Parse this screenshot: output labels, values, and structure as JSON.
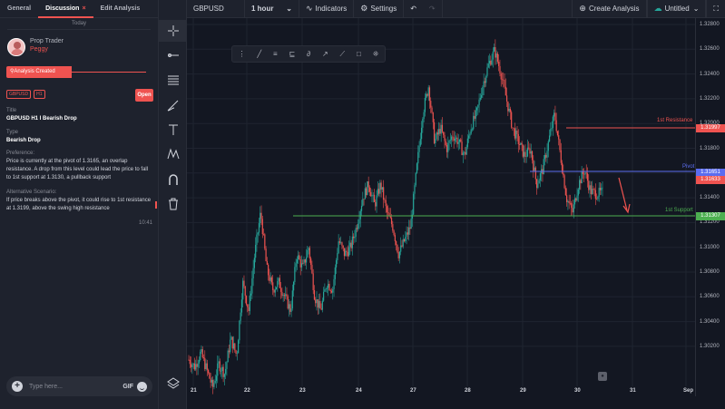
{
  "tabs": [
    {
      "label": "General"
    },
    {
      "label": "Discussion",
      "close": "×"
    },
    {
      "label": "Edit Analysis"
    }
  ],
  "today": "Today",
  "user": {
    "role": "Prop Trader",
    "name": "Peggy"
  },
  "created_label": "Analysis Created",
  "tags": [
    "GBPUSD",
    "H1"
  ],
  "open_label": "Open",
  "fields": {
    "title_label": "Title",
    "title_value": "GBPUSD H1 I Bearish Drop",
    "type_label": "Type",
    "type_value": "Bearish Drop",
    "preference_label": "Preference:",
    "preference_text": "Price is currently at the pivot of 1.3165, an overlap resistance. A drop from this level could lead the price to fall to 1st support at 1.3130, a pullback support",
    "alt_label": "Alternative Scenario:",
    "alt_text": "If price breaks above the pivot, it could rise to 1st resistance at 1.3199, above the swing high resistance"
  },
  "message_time": "10:41",
  "input": {
    "placeholder": "Type here...",
    "gif": "GIF"
  },
  "topbar": {
    "symbol": "GBPUSD",
    "timeframe": "1 hour",
    "indicators": "Indicators",
    "settings": "Settings",
    "create": "Create Analysis",
    "untitled": "Untitled"
  },
  "colors": {
    "accent": "#ef5350",
    "up": "#26a69a",
    "down": "#ef5350",
    "pivot": "#5b6cf0",
    "support": "#4caf50"
  },
  "price_labels": [
    "1.32800",
    "1.32600",
    "1.32400",
    "1.32200",
    "1.32000",
    "1.31800",
    "1.31600",
    "1.31400",
    "1.31200",
    "1.31000",
    "1.30800",
    "1.30600",
    "1.30400",
    "1.30200"
  ],
  "date_labels": [
    "21",
    "22",
    "23",
    "24",
    "27",
    "28",
    "29",
    "30",
    "31",
    "Sep"
  ],
  "levels": {
    "resistance": {
      "label": "1st Resistance",
      "price_tag": "1.31997"
    },
    "pivot": {
      "label": "Pivot",
      "price_tag": "1.31651"
    },
    "current": {
      "price_tag": "1.31633"
    },
    "support": {
      "label": "1st Support",
      "price_tag": "1.31307"
    }
  },
  "chart_data": {
    "type": "candlestick",
    "ylim": [
      1.3019,
      1.3288
    ],
    "x": [
      "21",
      "22",
      "23",
      "24",
      "27",
      "28",
      "29",
      "30",
      "31",
      "Sep"
    ],
    "close_path": [
      1.3045,
      1.304,
      1.305,
      1.3038,
      1.3025,
      1.3042,
      1.3035,
      1.306,
      1.3048,
      1.31,
      1.308,
      1.312,
      1.315,
      1.311,
      1.3095,
      1.31,
      1.309,
      1.308,
      1.312,
      1.311,
      1.3125,
      1.309,
      1.308,
      1.31,
      1.3095,
      1.313,
      1.312,
      1.3125,
      1.314,
      1.316,
      1.317,
      1.3155,
      1.317,
      1.315,
      1.314,
      1.312,
      1.313,
      1.314,
      1.318,
      1.322,
      1.324,
      1.32,
      1.321,
      1.3195,
      1.3205,
      1.32,
      1.319,
      1.321,
      1.322,
      1.324,
      1.3255,
      1.3265,
      1.325,
      1.323,
      1.321,
      1.32,
      1.319,
      1.3195,
      1.317,
      1.318,
      1.32,
      1.322,
      1.319,
      1.316,
      1.315,
      1.317,
      1.318,
      1.3165,
      1.3163,
      1.3164
    ]
  }
}
